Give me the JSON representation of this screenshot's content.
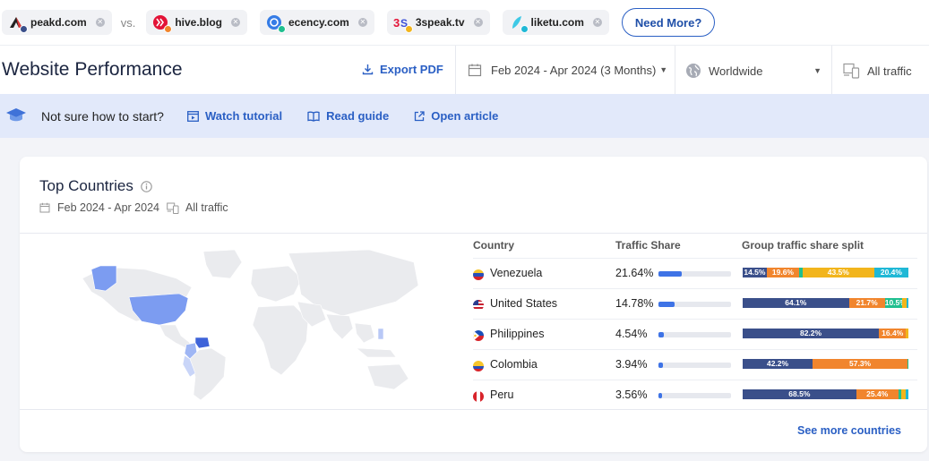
{
  "competitors": [
    {
      "name": "peakd.com",
      "dot_color": "#3a4f8a"
    },
    {
      "name": "hive.blog",
      "dot_color": "#f1852d"
    },
    {
      "name": "ecency.com",
      "dot_color": "#1fbf8f"
    },
    {
      "name": "3speak.tv",
      "dot_color": "#f2b51c"
    },
    {
      "name": "liketu.com",
      "dot_color": "#1fb8d6"
    }
  ],
  "vs_label": "vs.",
  "need_more_label": "Need More?",
  "header": {
    "title": "Website Performance",
    "export_label": "Export PDF",
    "date_range": "Feb 2024 - Apr 2024 (3 Months)",
    "region": "Worldwide",
    "traffic": "All traffic"
  },
  "tutorial": {
    "prompt": "Not sure how to start?",
    "watch": "Watch tutorial",
    "guide": "Read guide",
    "article": "Open article"
  },
  "top_countries": {
    "title": "Top Countries",
    "date": "Feb 2024 - Apr 2024",
    "traffic": "All traffic",
    "columns": {
      "country": "Country",
      "share": "Traffic Share",
      "split": "Group traffic share split"
    },
    "rows": [
      {
        "country": "Venezuela",
        "share": "21.64%",
        "share_value": 21.64,
        "split": [
          {
            "pct": 14.5,
            "label": "14.5%",
            "color": "#3a4f8a"
          },
          {
            "pct": 19.6,
            "label": "19.6%",
            "color": "#f1852d"
          },
          {
            "pct": 1.9,
            "label": "",
            "color": "#1fbf8f"
          },
          {
            "pct": 43.5,
            "label": "43.5%",
            "color": "#f2b51c"
          },
          {
            "pct": 20.4,
            "label": "20.4%",
            "color": "#1fb8d6"
          }
        ]
      },
      {
        "country": "United States",
        "share": "14.78%",
        "share_value": 14.78,
        "split": [
          {
            "pct": 64.1,
            "label": "64.1%",
            "color": "#3a4f8a"
          },
          {
            "pct": 21.7,
            "label": "21.7%",
            "color": "#f1852d"
          },
          {
            "pct": 10.5,
            "label": "10.5%",
            "color": "#1fbf8f"
          },
          {
            "pct": 2.5,
            "label": "",
            "color": "#f2b51c"
          },
          {
            "pct": 1.2,
            "label": "",
            "color": "#1fb8d6"
          }
        ]
      },
      {
        "country": "Philippines",
        "share": "4.54%",
        "share_value": 4.54,
        "split": [
          {
            "pct": 82.2,
            "label": "82.2%",
            "color": "#3a4f8a"
          },
          {
            "pct": 16.4,
            "label": "16.4%",
            "color": "#f1852d"
          },
          {
            "pct": 1.4,
            "label": "",
            "color": "#f2b51c"
          }
        ]
      },
      {
        "country": "Colombia",
        "share": "3.94%",
        "share_value": 3.94,
        "split": [
          {
            "pct": 42.2,
            "label": "42.2%",
            "color": "#3a4f8a"
          },
          {
            "pct": 57.3,
            "label": "57.3%",
            "color": "#f1852d"
          },
          {
            "pct": 0.5,
            "label": "",
            "color": "#1fbf8f"
          }
        ]
      },
      {
        "country": "Peru",
        "share": "3.56%",
        "share_value": 3.56,
        "split": [
          {
            "pct": 68.5,
            "label": "68.5%",
            "color": "#3a4f8a"
          },
          {
            "pct": 25.4,
            "label": "25.4%",
            "color": "#f1852d"
          },
          {
            "pct": 2.0,
            "label": "",
            "color": "#1fbf8f"
          },
          {
            "pct": 2.6,
            "label": "",
            "color": "#f2b51c"
          },
          {
            "pct": 1.5,
            "label": "",
            "color": "#1fb8d6"
          }
        ]
      }
    ],
    "see_more": "See more countries"
  }
}
